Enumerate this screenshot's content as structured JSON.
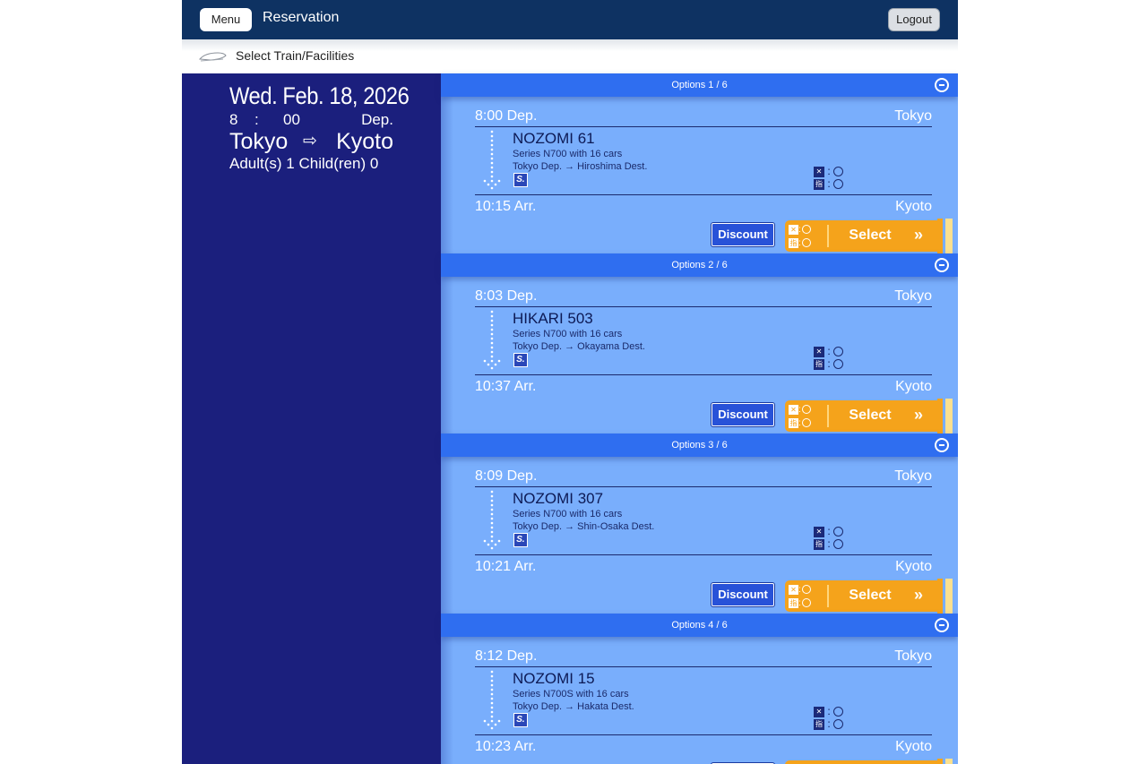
{
  "header": {
    "menu_label": "Menu",
    "title": "Reservation",
    "logout_label": "Logout"
  },
  "subheader": {
    "title": "Select Train/Facilities",
    "icon": "shinkansen-icon"
  },
  "search": {
    "date": "Wed. Feb. 18, 2026",
    "hour": "8",
    "time_sep": ":",
    "minute": "00",
    "time_type": "Dep.",
    "from": "Tokyo",
    "route_arrow": "⇨",
    "to": "Kyoto",
    "passengers": "Adult(s) 1 Child(ren) 0"
  },
  "labels": {
    "discount": "Discount",
    "select": "Select",
    "select_chevron": "»",
    "seat_colon": ":",
    "smoking_icon_text": "S.",
    "unreserved_icon_text": "✕",
    "reserved_icon_text": "指"
  },
  "options": [
    {
      "header": "Options 1 / 6",
      "dep_time": "8:00 Dep.",
      "dep_station": "Tokyo",
      "train_name": "NOZOMI 61",
      "series": "Series N700 with 16 cars",
      "destination": "Tokyo Dep. → Hiroshima Dest.",
      "arr_time": "10:15 Arr.",
      "arr_station": "Kyoto"
    },
    {
      "header": "Options 2 / 6",
      "dep_time": "8:03 Dep.",
      "dep_station": "Tokyo",
      "train_name": "HIKARI 503",
      "series": "Series N700 with 16 cars",
      "destination": "Tokyo Dep. → Okayama Dest.",
      "arr_time": "10:37 Arr.",
      "arr_station": "Kyoto"
    },
    {
      "header": "Options 3 / 6",
      "dep_time": "8:09 Dep.",
      "dep_station": "Tokyo",
      "train_name": "NOZOMI 307",
      "series": "Series N700 with 16 cars",
      "destination": "Tokyo Dep. → Shin-Osaka Dest.",
      "arr_time": "10:21 Arr.",
      "arr_station": "Kyoto"
    },
    {
      "header": "Options 4 / 6",
      "dep_time": "8:12 Dep.",
      "dep_station": "Tokyo",
      "train_name": "NOZOMI 15",
      "series": "Series N700S with 16 cars",
      "destination": "Tokyo Dep. → Hakata Dest.",
      "arr_time": "10:23 Arr.",
      "arr_station": "Kyoto"
    }
  ],
  "colors": {
    "header_bg": "#0e3262",
    "left_panel_bg": "#1b1f7d",
    "list_bg": "#79aefc",
    "option_bar": "#2f6ef0",
    "select_button": "#f5a31b",
    "discount_button": "#2852d8"
  }
}
